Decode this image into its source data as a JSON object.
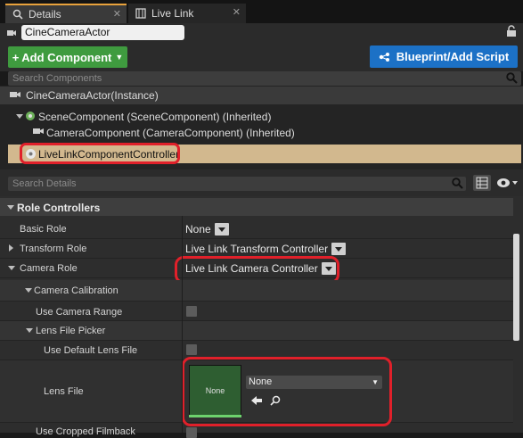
{
  "tabs": [
    {
      "label": "Details",
      "icon": "details-icon"
    },
    {
      "label": "Live Link",
      "icon": "live-link-icon"
    }
  ],
  "actor": {
    "name": "CineCameraActor"
  },
  "toolbar": {
    "add_component_label": "Add Component",
    "blueprint_label": "Blueprint/Add Script"
  },
  "components": {
    "search_placeholder": "Search Components",
    "items": [
      "CineCameraActor(Instance)",
      "SceneComponent (SceneComponent) (Inherited)",
      "CameraComponent (CameraComponent) (Inherited)",
      "LiveLinkComponentController"
    ],
    "selected": "LiveLinkComponentController"
  },
  "details": {
    "search_placeholder": "Search Details",
    "category": "Role Controllers",
    "rows": {
      "basic_role": {
        "label": "Basic Role",
        "value": "None"
      },
      "transform_role": {
        "label": "Transform Role",
        "value": "Live Link Transform Controller"
      },
      "camera_role": {
        "label": "Camera Role",
        "value": "Live Link Camera Controller"
      },
      "camera_calibration": {
        "label": "Camera Calibration"
      },
      "use_camera_range": {
        "label": "Use Camera Range",
        "checked": false
      },
      "lens_file_picker": {
        "label": "Lens File Picker"
      },
      "use_default_lens_file": {
        "label": "Use Default Lens File",
        "checked": false
      },
      "lens_file": {
        "label": "Lens File",
        "thumbnail_text": "None",
        "value": "None"
      },
      "use_cropped_filmback": {
        "label": "Use Cropped Filmback",
        "checked": false
      }
    }
  },
  "colors": {
    "accent": "#e8a23c",
    "add_button": "#3f9b3f",
    "blueprint_button": "#1c71c6",
    "highlight": "#e0202a",
    "selection": "#d2b88e"
  }
}
